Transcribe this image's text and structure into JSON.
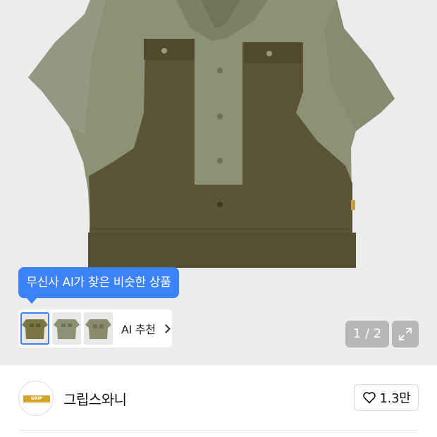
{
  "gallery": {
    "counter": "1 / 2",
    "expand_icon": "expand-arrows-icon"
  },
  "ai": {
    "tooltip": "무신사 AI가 찾은 비슷한 상품",
    "recommend_label": "AI 추천",
    "chevron_icon": "chevron-right-icon"
  },
  "brand": {
    "logo_text": "GRIP SWANY",
    "name": "그립스와니"
  },
  "like": {
    "icon": "heart-icon",
    "count": "1.3만"
  },
  "colors": {
    "accent_blue": "#3b82f6",
    "shirt_light": "#8d9277",
    "shirt_dark": "#5b5535",
    "logo_gold": "#d4a52a"
  }
}
